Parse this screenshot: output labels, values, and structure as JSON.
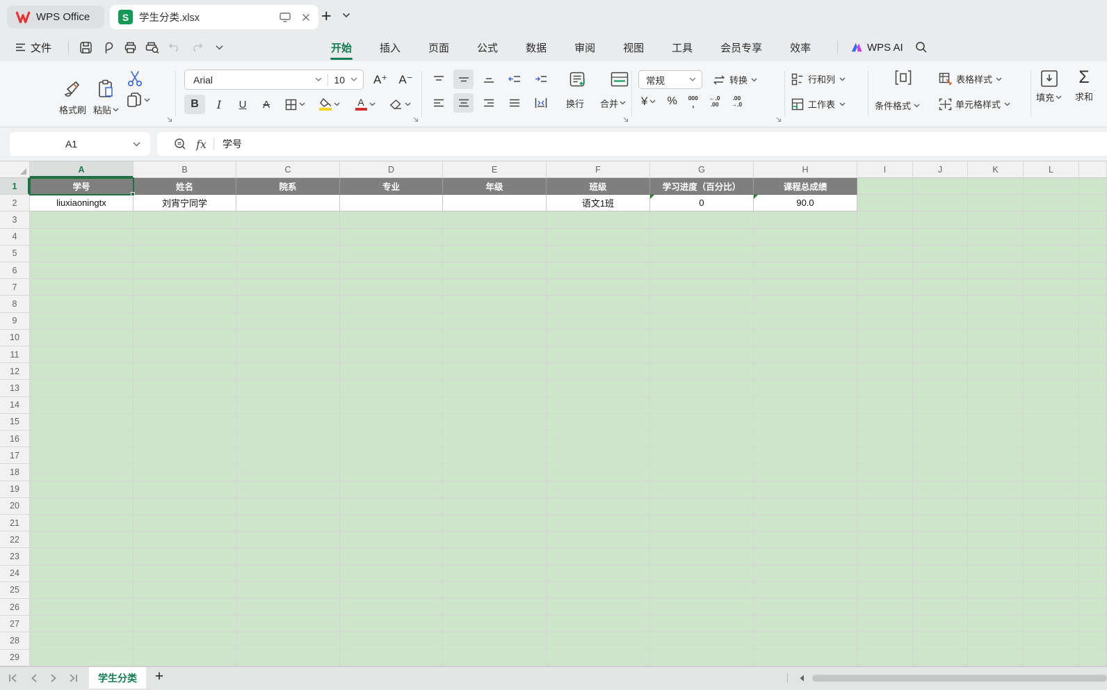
{
  "titlebar": {
    "app_name": "WPS Office",
    "doc_title": "学生分类.xlsx",
    "new_tab": "+"
  },
  "menubar": {
    "file_label": "文件",
    "tabs": [
      "开始",
      "插入",
      "页面",
      "公式",
      "数据",
      "审阅",
      "视图",
      "工具",
      "会员专享",
      "效率"
    ],
    "active_tab": "开始",
    "wps_ai_label": "WPS AI"
  },
  "toolbar": {
    "format_painter": "格式刷",
    "paste": "粘贴",
    "font_family": "Arial",
    "font_size": "10",
    "grow_font": "A⁺",
    "shrink_font": "A⁻",
    "bold": "B",
    "italic": "I",
    "underline": "U",
    "strike": "A",
    "wrap": "换行",
    "merge": "合并",
    "number_format": "常规",
    "convert": "转换",
    "currency": "¥",
    "percent": "%",
    "thousands_top": "000",
    "thousands_bottom": ",",
    "inc_dec_top": "←.0",
    "inc_dec_bottom": ".00",
    "dec_dec_top": ".00",
    "dec_dec_bottom": "→.0",
    "rows_cols": "行和列",
    "worksheet": "工作表",
    "cond_format": "条件格式",
    "table_style": "表格样式",
    "cell_style": "单元格样式",
    "fill": "填充",
    "sum_label": "求和",
    "sum_symbol": "Σ"
  },
  "formula_bar": {
    "name_box": "A1",
    "fx": "fx",
    "content": "学号"
  },
  "grid": {
    "selected_cell": "A1",
    "col_letters": [
      "A",
      "B",
      "C",
      "D",
      "E",
      "F",
      "G",
      "H",
      "I",
      "J",
      "K",
      "L",
      ""
    ],
    "header_row": [
      "学号",
      "姓名",
      "院系",
      "专业",
      "年级",
      "班级",
      "学习进度（百分比）",
      "课程总成绩"
    ],
    "data_row": [
      "liuxiaoningtx",
      "刘宵宁同学",
      "",
      "",
      "",
      "语文1班",
      "0",
      "90.0"
    ],
    "error_cell_columns": [
      6,
      7
    ],
    "visible_rows": 29
  },
  "sheetbar": {
    "active_tab": "学生分类",
    "add_tab": "+"
  }
}
